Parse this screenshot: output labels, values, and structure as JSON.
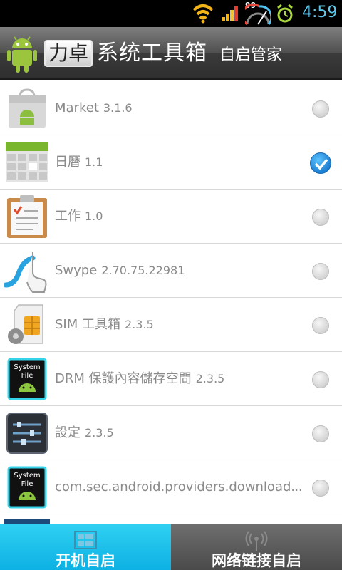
{
  "status_bar": {
    "battery_label": "99",
    "clock": "4:59",
    "icons": [
      "wifi-icon",
      "signal-icon",
      "gauge-icon",
      "alarm-icon"
    ]
  },
  "header": {
    "title_boxed": "力卓",
    "title_rest": "系统工具箱",
    "subtitle": "自启管家"
  },
  "apps": [
    {
      "name": "Market",
      "version": "3.1.6",
      "checked": false,
      "icon": "market-icon"
    },
    {
      "name": "日曆",
      "version": "1.1",
      "checked": true,
      "icon": "calendar-icon"
    },
    {
      "name": "工作",
      "version": "1.0",
      "checked": false,
      "icon": "clipboard-icon"
    },
    {
      "name": "Swype",
      "version": "2.70.75.22981",
      "checked": false,
      "icon": "swype-icon"
    },
    {
      "name": "SIM 工具箱",
      "version": "2.3.5",
      "checked": false,
      "icon": "sim-toolkit-icon"
    },
    {
      "name": "DRM 保護內容儲存空間",
      "version": "2.3.5",
      "checked": false,
      "icon": "system-file-icon"
    },
    {
      "name": "設定",
      "version": "2.3.5",
      "checked": false,
      "icon": "settings-icon"
    },
    {
      "name": "com.sec.android.providers.downloads.C...",
      "version": "",
      "checked": false,
      "icon": "system-file-icon"
    }
  ],
  "tabs": [
    {
      "label": "开机自启",
      "active": true,
      "icon": "boot-icon"
    },
    {
      "label": "网络链接自启",
      "active": false,
      "icon": "network-icon"
    }
  ],
  "colors": {
    "accent": "#0db1e3",
    "clock": "#5ec9ef",
    "check_on": "#1e7fd2",
    "text_gray": "#8a8a8a"
  }
}
